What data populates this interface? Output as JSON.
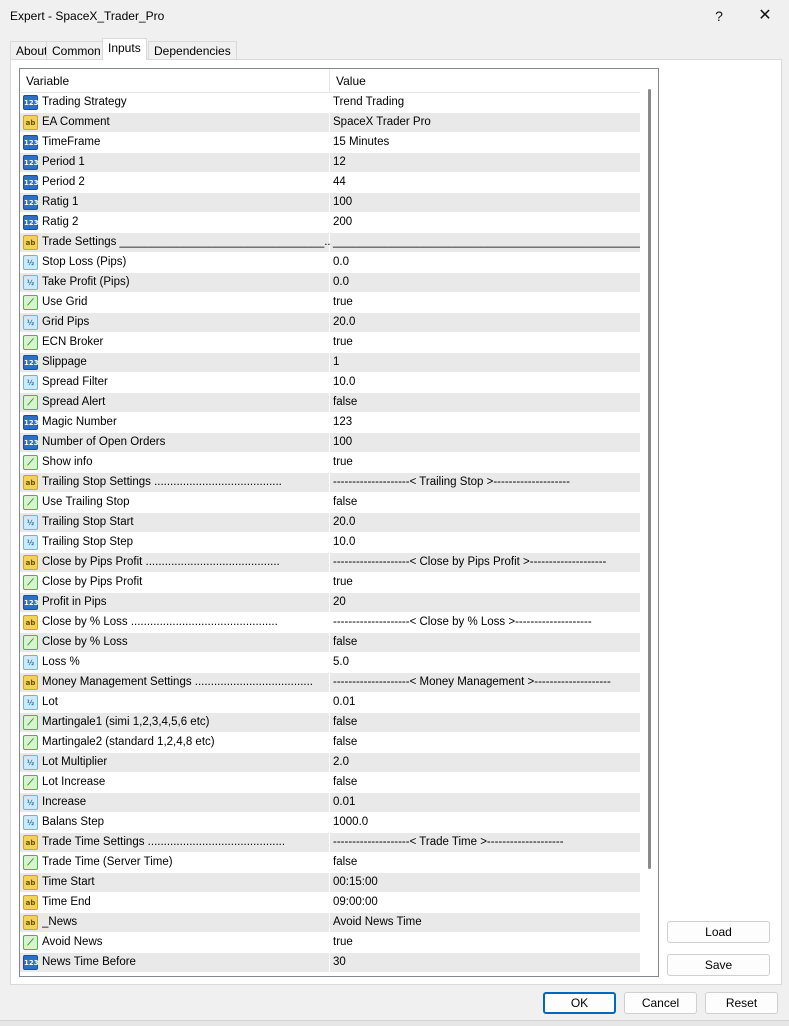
{
  "window": {
    "title": "Expert - SpaceX_Trader_Pro",
    "help_label": "?",
    "close_label": "✕"
  },
  "tabs": [
    "About",
    "Common",
    "Inputs",
    "Dependencies"
  ],
  "active_tab": "Inputs",
  "grid": {
    "col_variable": "Variable",
    "col_value": "Value",
    "rows": [
      {
        "type": "int",
        "variable": "Trading Strategy",
        "value": "Trend Trading"
      },
      {
        "type": "str",
        "variable": "EA Comment",
        "value": "SpaceX Trader Pro"
      },
      {
        "type": "int",
        "variable": "TimeFrame",
        "value": "15 Minutes"
      },
      {
        "type": "int",
        "variable": "Period 1",
        "value": "12"
      },
      {
        "type": "int",
        "variable": "Period 2",
        "value": "44"
      },
      {
        "type": "int",
        "variable": "Ratig 1",
        "value": "100"
      },
      {
        "type": "int",
        "variable": "Ratig 2",
        "value": "200"
      },
      {
        "type": "str",
        "variable": "Trade Settings ________________________________...",
        "value": "__________________________________________________..."
      },
      {
        "type": "dbl",
        "variable": "Stop Loss (Pips)",
        "value": "0.0"
      },
      {
        "type": "dbl",
        "variable": "Take Profit (Pips)",
        "value": "0.0"
      },
      {
        "type": "bool",
        "variable": "Use Grid",
        "value": "true"
      },
      {
        "type": "dbl",
        "variable": "Grid Pips",
        "value": "20.0"
      },
      {
        "type": "bool",
        "variable": "ECN Broker",
        "value": "true"
      },
      {
        "type": "int",
        "variable": "Slippage",
        "value": "1"
      },
      {
        "type": "dbl",
        "variable": "Spread Filter",
        "value": "10.0"
      },
      {
        "type": "bool",
        "variable": "Spread Alert",
        "value": "false"
      },
      {
        "type": "int",
        "variable": "Magic Number",
        "value": "123"
      },
      {
        "type": "int",
        "variable": "Number of Open Orders",
        "value": "100"
      },
      {
        "type": "bool",
        "variable": "Show info",
        "value": "true"
      },
      {
        "type": "str",
        "variable": "Trailing Stop Settings ........................................",
        "value": "--------------------< Trailing Stop >--------------------"
      },
      {
        "type": "bool",
        "variable": "Use Trailing Stop",
        "value": "false"
      },
      {
        "type": "dbl",
        "variable": "Trailing Stop Start",
        "value": "20.0"
      },
      {
        "type": "dbl",
        "variable": "Trailing Stop Step",
        "value": "10.0"
      },
      {
        "type": "str",
        "variable": "Close by Pips Profit ..........................................",
        "value": "--------------------< Close by Pips Profit >--------------------"
      },
      {
        "type": "bool",
        "variable": "Close by Pips Profit",
        "value": "true"
      },
      {
        "type": "int",
        "variable": "Profit in Pips",
        "value": "20"
      },
      {
        "type": "str",
        "variable": "Close by % Loss ..............................................",
        "value": "--------------------< Close by % Loss >--------------------"
      },
      {
        "type": "bool",
        "variable": "Close by % Loss",
        "value": "false"
      },
      {
        "type": "dbl",
        "variable": "Loss %",
        "value": "5.0"
      },
      {
        "type": "str",
        "variable": "Money Management Settings .....................................",
        "value": "--------------------< Money Management >--------------------"
      },
      {
        "type": "dbl",
        "variable": "Lot",
        "value": "0.01"
      },
      {
        "type": "bool",
        "variable": "Martingale1 (simi 1,2,3,4,5,6 etc)",
        "value": "false"
      },
      {
        "type": "bool",
        "variable": "Martingale2 (standard 1,2,4,8 etc)",
        "value": "false"
      },
      {
        "type": "dbl",
        "variable": "Lot Multiplier",
        "value": "2.0"
      },
      {
        "type": "bool",
        "variable": "Lot Increase",
        "value": "false"
      },
      {
        "type": "dbl",
        "variable": "Increase",
        "value": "0.01"
      },
      {
        "type": "dbl",
        "variable": "Balans Step",
        "value": "1000.0"
      },
      {
        "type": "str",
        "variable": "Trade Time Settings ...........................................",
        "value": "--------------------< Trade Time >--------------------"
      },
      {
        "type": "bool",
        "variable": "Trade Time (Server Time)",
        "value": "false"
      },
      {
        "type": "str",
        "variable": "Time Start",
        "value": "00:15:00"
      },
      {
        "type": "str",
        "variable": "Time End",
        "value": "09:00:00"
      },
      {
        "type": "str",
        "variable": "_News",
        "value": "Avoid News Time"
      },
      {
        "type": "bool",
        "variable": "Avoid News",
        "value": "true"
      },
      {
        "type": "int",
        "variable": "News Time Before",
        "value": "30"
      }
    ]
  },
  "icons": {
    "int": {
      "name": "integer-type-icon",
      "glyph": "123"
    },
    "str": {
      "name": "string-type-icon",
      "glyph": "ab"
    },
    "dbl": {
      "name": "double-type-icon",
      "glyph": "½"
    },
    "bool": {
      "name": "boolean-type-icon",
      "glyph": "⟋"
    }
  },
  "buttons": {
    "load": "Load",
    "save": "Save",
    "ok": "OK",
    "cancel": "Cancel",
    "reset": "Reset"
  },
  "colors": {
    "accent": "#0067c0",
    "row_alt": "#e9e9e9"
  }
}
